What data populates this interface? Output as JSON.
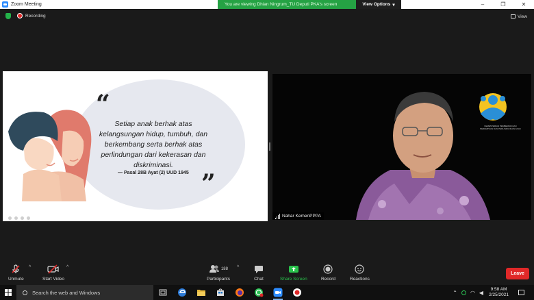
{
  "window": {
    "title": "Zoom Meeting",
    "minimize": "–",
    "maximize": "❐",
    "close": "✕"
  },
  "share_banner": {
    "message": "You are viewing Dhian Ningrum_TU Deputi PKA's screen",
    "view_options": "View Options",
    "view_options_caret": "▾"
  },
  "meeting_bar": {
    "recording": "Recording",
    "view": "View"
  },
  "slide": {
    "quote_open": "“",
    "quote_close": "”",
    "quote_text": "Setiap anak berhak atas kelangsungan hidup, tumbuh, dan berkembang serta berhak atas perlindungan dari kekerasan dan diskriminasi.",
    "quote_source": "— Pasal 28B Ayat (2) UUD 1945"
  },
  "video": {
    "participant_name": "Nahar KemenPPPA",
    "logo_caption": "KEMENTERIAN PEMBERDAYAAN PEREMPUAN DAN PERLINDUNGAN ANAK"
  },
  "toolbar": {
    "unmute": "Unmute",
    "start_video": "Start Video",
    "participants": "Participants",
    "participants_count": "188",
    "chat": "Chat",
    "share_screen": "Share Screen",
    "record": "Record",
    "reactions": "Reactions",
    "leave": "Leave",
    "caret": "^"
  },
  "taskbar": {
    "search_placeholder": "Search the web and Windows",
    "time": "9:58 AM",
    "date": "2/25/2021"
  },
  "colors": {
    "zoom_blue": "#2d8cff",
    "share_green": "#25a244",
    "leave_red": "#e02828",
    "record_red": "#e02828"
  }
}
